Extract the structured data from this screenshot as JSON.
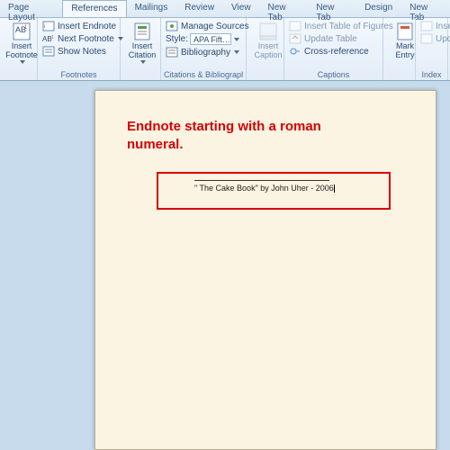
{
  "tabs": {
    "page_layout": "Page Layout",
    "references": "References",
    "mailings": "Mailings",
    "review": "Review",
    "view": "View",
    "new_tab": "New Tab",
    "new_tab2": "New Tab",
    "design": "Design",
    "new_tab3": "New Tab"
  },
  "groups": {
    "footnotes_label": "Footnotes",
    "citations_label": "Citations & Bibliography",
    "captions_label": "Captions",
    "index_label": "Index"
  },
  "footnotes": {
    "insert_footnote": "Insert\nFootnote",
    "insert_endnote": "Insert Endnote",
    "next_footnote": "Next Footnote",
    "show_notes": "Show Notes"
  },
  "citations": {
    "insert_citation": "Insert\nCitation",
    "manage_sources": "Manage Sources",
    "style_label": "Style:",
    "style_value": "APA Fift…",
    "bibliography": "Bibliography"
  },
  "captions": {
    "insert_caption": "Insert\nCaption",
    "insert_tof": "Insert Table of Figures",
    "update_table": "Update Table",
    "cross_reference": "Cross-reference"
  },
  "index": {
    "mark_entry": "Mark\nEntry",
    "insert_index": "Insert",
    "update_index": "Updat"
  },
  "annotation": {
    "title": "Endnote starting with a roman numeral.",
    "endnote_text": "\" The Cake Book\" by John Uher - 2006"
  }
}
